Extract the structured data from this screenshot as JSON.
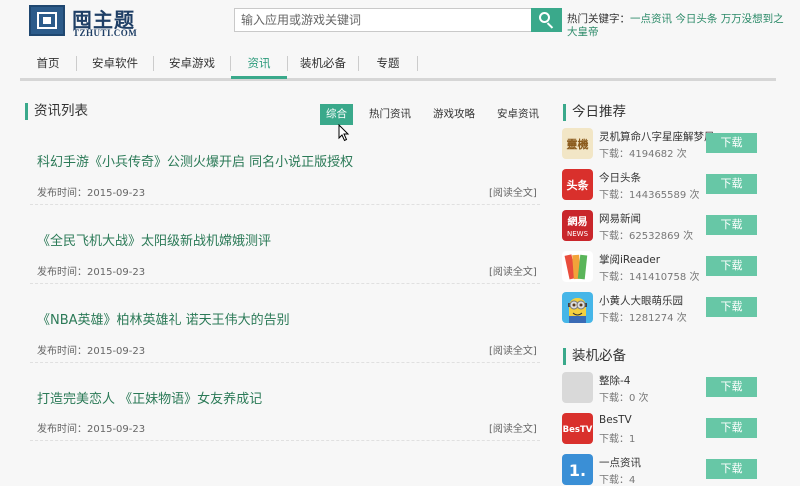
{
  "header": {
    "logo_name": "囤主题",
    "logo_sub": "TZHUTI.COM",
    "search_placeholder": "输入应用或游戏关键词",
    "hot_label": "热门关键字：",
    "hot_keywords": [
      "一点资讯",
      "今日头条",
      "万万没想到之大皇帝"
    ]
  },
  "nav": {
    "items": [
      "首页",
      "安卓软件",
      "安卓游戏",
      "资讯",
      "装机必备",
      "专题"
    ],
    "active": "资讯"
  },
  "news": {
    "title": "资讯列表",
    "tabs": [
      "综合",
      "热门资讯",
      "游戏攻略",
      "安卓资讯"
    ],
    "active_tab": "综合",
    "articles": [
      {
        "title": "科幻手游《小兵传奇》公测火爆开启 同名小说正版授权",
        "date": "发布时间：2015-09-23",
        "more": "[阅读全文]"
      },
      {
        "title": "《全民飞机大战》太阳级新战机嫦娥测评",
        "date": "发布时间：2015-09-23",
        "more": "[阅读全文]"
      },
      {
        "title": "《NBA英雄》柏林英雄礼 诺天王伟大的告别",
        "date": "发布时间：2015-09-23",
        "more": "[阅读全文]"
      },
      {
        "title": "打造完美恋人 《正妹物语》女友养成记",
        "date": "发布时间：2015-09-23",
        "more": "[阅读全文]"
      }
    ]
  },
  "today": {
    "title": "今日推荐",
    "apps": [
      {
        "name": "灵机算命八字星座解梦风",
        "downloads": "下载：4194682 次",
        "button": "下载",
        "icon": "lingji-icon",
        "icon_text": "靈機",
        "color": "#f2e6c6"
      },
      {
        "name": "今日头条",
        "downloads": "下载：144365589 次",
        "button": "下载",
        "icon": "toutiao-icon",
        "icon_text": "头条",
        "color": "#d9302c"
      },
      {
        "name": "网易新闻",
        "downloads": "下载：62532869 次",
        "button": "下载",
        "icon": "netease-news-icon",
        "icon_text": "網易",
        "color": "#c9262b"
      },
      {
        "name": "掌阅iReader",
        "downloads": "下载：141410758 次",
        "button": "下载",
        "icon": "ireader-icon",
        "icon_text": "",
        "color": "#e94d3c"
      },
      {
        "name": "小黄人大眼萌乐园",
        "downloads": "下载：1281274 次",
        "button": "下载",
        "icon": "minion-icon",
        "icon_text": "",
        "color": "#46b6e8"
      }
    ]
  },
  "essential": {
    "title": "装机必备",
    "apps": [
      {
        "name": "整除-4",
        "downloads": "下载：0 次",
        "button": "下载",
        "icon": "placeholder-icon",
        "icon_text": "",
        "color": "#d9d9d9"
      },
      {
        "name": "BesTV",
        "downloads": "下载：1",
        "button": "下载",
        "icon": "bestv-icon",
        "icon_text": "BesTV",
        "color": "#d9302c"
      },
      {
        "name": "一点资讯",
        "downloads": "下载：4",
        "button": "下载",
        "icon": "yidian-icon",
        "icon_text": "1.",
        "color": "#3a8fd6"
      }
    ]
  }
}
